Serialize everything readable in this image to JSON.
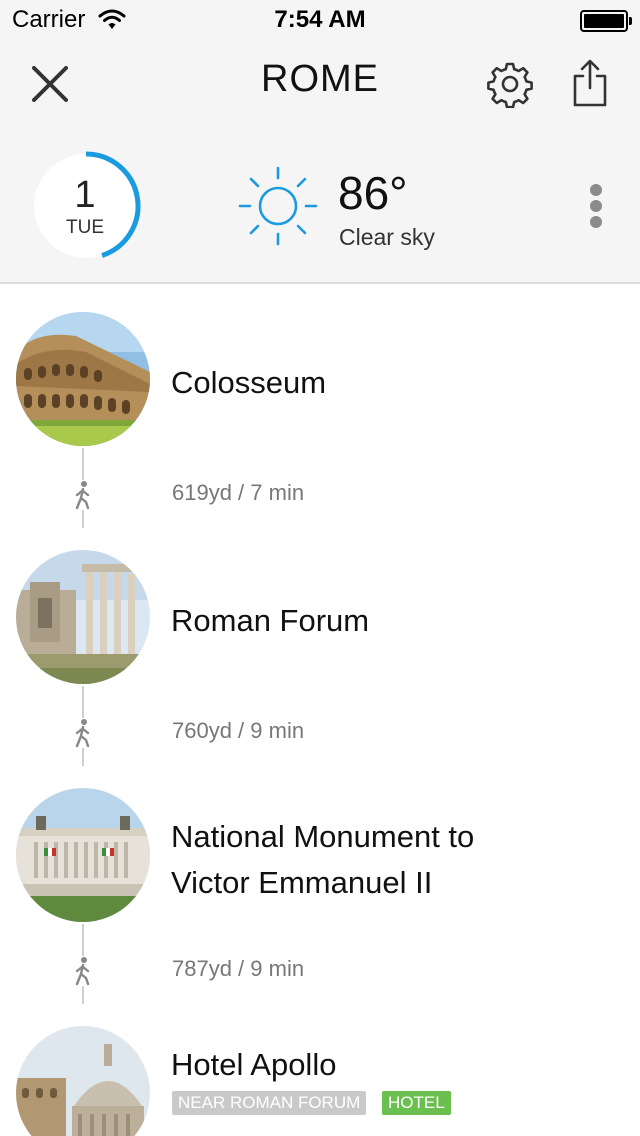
{
  "status_bar": {
    "carrier": "Carrier",
    "time": "7:54 AM"
  },
  "header": {
    "title": "ROME",
    "close_icon": "close-icon",
    "settings_icon": "gear-icon",
    "share_icon": "share-icon",
    "more_icon": "more-vertical-icon"
  },
  "day": {
    "number": "1",
    "weekday": "TUE",
    "progress_fraction": 0.45,
    "accent_color": "#1a9be0"
  },
  "weather": {
    "icon": "sun-icon",
    "temperature": "86°",
    "condition": "Clear sky",
    "icon_color": "#1a9be0"
  },
  "itinerary": [
    {
      "name": "Colosseum",
      "walk": "619yd / 7 min",
      "tags": []
    },
    {
      "name": "Roman Forum",
      "walk": "760yd / 9 min",
      "tags": []
    },
    {
      "name_line1": "National Monument to",
      "name_line2": "Victor Emmanuel II",
      "walk": "787yd / 9 min",
      "tags": []
    },
    {
      "name": "Hotel Apollo",
      "tags": [
        "NEAR ROMAN FORUM",
        "HOTEL"
      ]
    }
  ],
  "colors": {
    "header_bg": "#f5f5f5",
    "hotel_tag": "#6bbf4e",
    "near_tag": "#c9c9c9"
  }
}
